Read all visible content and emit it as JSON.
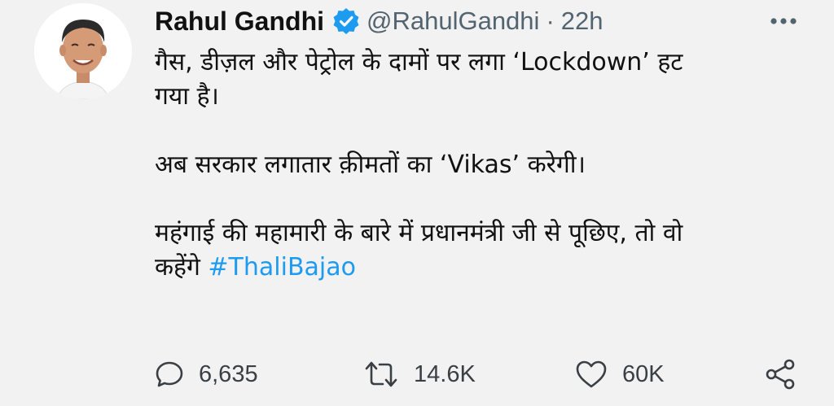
{
  "author": {
    "display_name": "Rahul Gandhi",
    "handle": "@RahulGandhi",
    "separator": "·",
    "time": "22h"
  },
  "tweet": {
    "line1": "गैस, डीज़ल और पेट्रोल के दामों पर लगा ‘Lockdown’ हट",
    "line2": "गया है।",
    "line3": "अब सरकार लगातार क़ीमतों का ‘Vikas’ करेगी।",
    "line4": "महंगाई की महामारी के बारे में प्रधानमंत्री जी से पूछिए, तो वो",
    "line5_prefix": "कहेंगे",
    "hashtag": "#ThaliBajao"
  },
  "stats": {
    "replies": "6,635",
    "retweets": "14.6K",
    "likes": "60K"
  },
  "icons": {
    "verified": "verified-badge-icon",
    "more": "more-options-icon",
    "reply": "reply-icon",
    "retweet": "retweet-icon",
    "like": "heart-icon",
    "share": "share-icon"
  },
  "colors": {
    "background": "#f2f2f2",
    "accent": "#1d9bf0",
    "secondary_text": "#536471"
  }
}
